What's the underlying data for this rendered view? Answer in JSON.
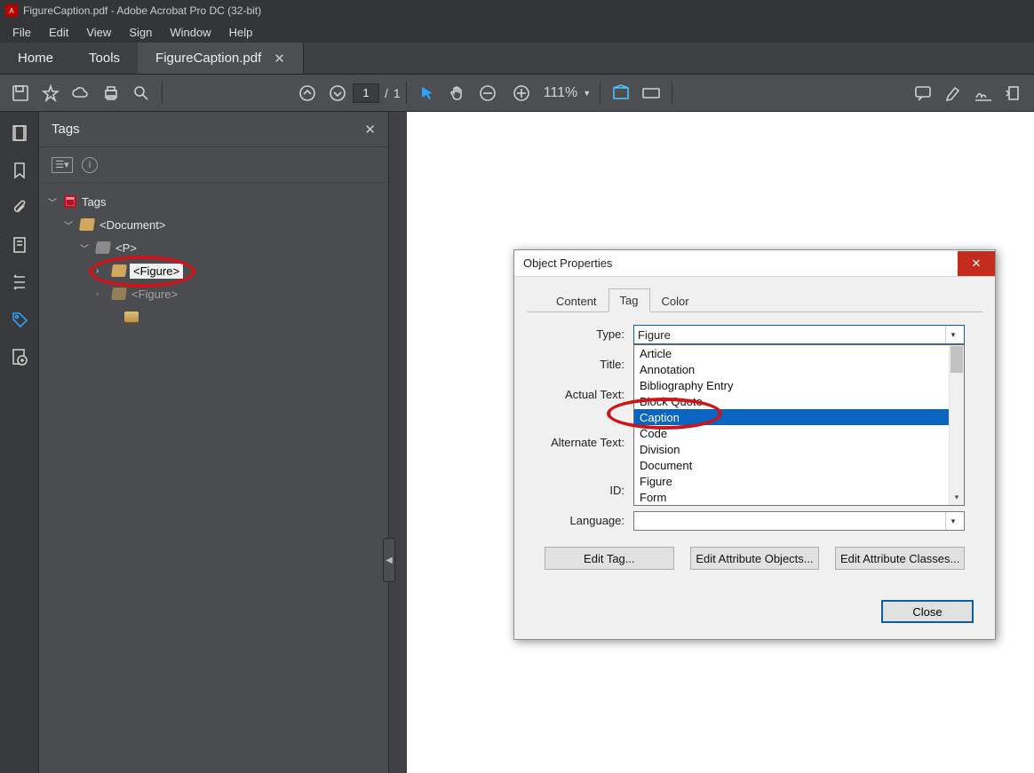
{
  "window": {
    "title": "FigureCaption.pdf - Adobe Acrobat Pro DC (32-bit)"
  },
  "menu": {
    "items": [
      "File",
      "Edit",
      "View",
      "Sign",
      "Window",
      "Help"
    ]
  },
  "docTabs": {
    "home": "Home",
    "tools": "Tools",
    "file": "FigureCaption.pdf"
  },
  "toolbar": {
    "page_current": "1",
    "page_sep": "/",
    "page_total": "1",
    "zoom_value": "111%"
  },
  "navPanel": {
    "title": "Tags",
    "tree": {
      "root": "Tags",
      "doc": "<Document>",
      "p": "<P>",
      "figure1": "<Figure>",
      "figure2": "<Figure>"
    }
  },
  "dialog": {
    "title": "Object Properties",
    "tabs": {
      "content": "Content",
      "tag": "Tag",
      "color": "Color"
    },
    "labels": {
      "type": "Type:",
      "title": "Title:",
      "actual": "Actual Text:",
      "alternate": "Alternate Text:",
      "id": "ID:",
      "language": "Language:"
    },
    "type_value": "Figure",
    "dropdown": [
      "Article",
      "Annotation",
      "Bibliography Entry",
      "Block Quote",
      "Caption",
      "Code",
      "Division",
      "Document",
      "Figure",
      "Form"
    ],
    "dropdown_selected": "Caption",
    "buttons": {
      "editTag": "Edit Tag...",
      "editAttrObj": "Edit Attribute Objects...",
      "editAttrCls": "Edit Attribute Classes...",
      "close": "Close"
    }
  }
}
